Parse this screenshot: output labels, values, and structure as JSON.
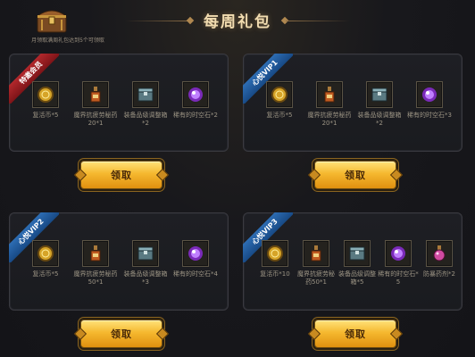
{
  "header": {
    "title": "每周礼包",
    "chest_note": "月领取满周礼包达到5个可领取"
  },
  "panels": [
    {
      "tag": "特邀会员",
      "tag_color": "#b3282c",
      "items": [
        {
          "icon": "gold-coin-icon",
          "label": "复活币*5"
        },
        {
          "icon": "potion-bottle-icon",
          "label": "魔界抗疲劳秘药20*1"
        },
        {
          "icon": "equipment-chest-icon",
          "label": "装备品级调整箱*2"
        },
        {
          "icon": "purple-orb-icon",
          "label": "稀有的时空石*2"
        }
      ],
      "button": "领取"
    },
    {
      "tag": "心悦VIP1",
      "tag_color": "#2d6db4",
      "items": [
        {
          "icon": "gold-coin-icon",
          "label": "复活币*5"
        },
        {
          "icon": "potion-bottle-icon",
          "label": "魔界抗疲劳秘药20*1"
        },
        {
          "icon": "equipment-chest-icon",
          "label": "装备品级调整箱*2"
        },
        {
          "icon": "purple-orb-icon",
          "label": "稀有的时空石*3"
        }
      ],
      "button": "领取"
    },
    {
      "tag": "心悦VIP2",
      "tag_color": "#2d6db4",
      "items": [
        {
          "icon": "gold-coin-icon",
          "label": "复活币*5"
        },
        {
          "icon": "potion-bottle-icon",
          "label": "魔界抗疲劳秘药50*1"
        },
        {
          "icon": "equipment-chest-icon",
          "label": "装备品级调整箱*3"
        },
        {
          "icon": "purple-orb-icon",
          "label": "稀有的时空石*4"
        }
      ],
      "button": "领取"
    },
    {
      "tag": "心悦VIP3",
      "tag_color": "#2d6db4",
      "items": [
        {
          "icon": "gold-coin-icon",
          "label": "复活币*10"
        },
        {
          "icon": "potion-bottle-icon",
          "label": "魔界抗疲劳秘药50*1"
        },
        {
          "icon": "equipment-chest-icon",
          "label": "装备品级调整箱*5"
        },
        {
          "icon": "purple-orb-icon",
          "label": "稀有的时空石*5"
        },
        {
          "icon": "pink-potion-icon",
          "label": "防暴药剂*2"
        }
      ],
      "button": "领取"
    }
  ],
  "colors": {
    "button_gold": "#f5b82f",
    "title_text": "#f1dcb0"
  }
}
